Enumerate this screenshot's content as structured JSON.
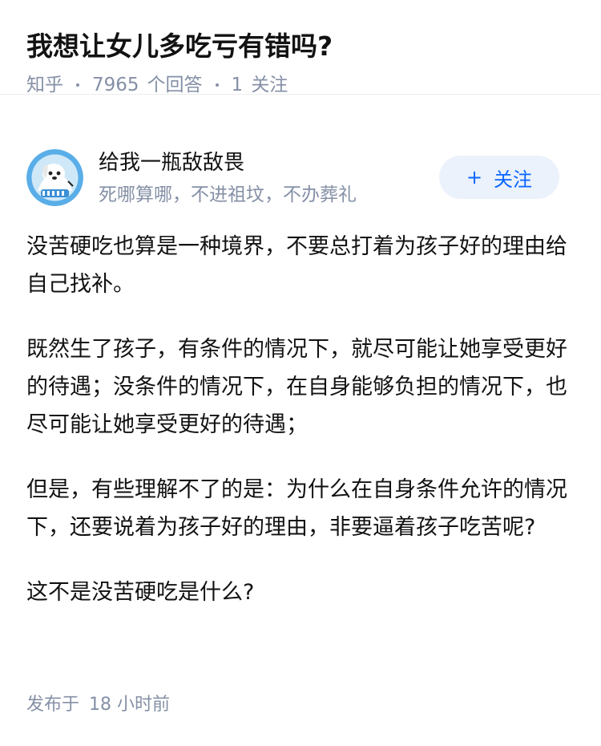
{
  "question": {
    "title": "我想让女儿多吃亏有错吗?",
    "source": "知乎",
    "answer_count": "7965",
    "answer_label": "个回答",
    "follow_count": "1",
    "follow_label": "关注"
  },
  "author": {
    "name": "给我一瓶敌敌畏",
    "bio": "死哪算哪，不进祖坟，不办葬礼",
    "avatar_icon": "dog-avatar-icon",
    "follow_button": {
      "icon": "plus-icon",
      "plus": "+",
      "label": "关注"
    }
  },
  "answer": {
    "paragraphs": [
      "没苦硬吃也算是一种境界，不要总打着为孩子好的理由给自己找补。",
      "既然生了孩子，有条件的情况下，就尽可能让她享受更好的待遇；没条件的情况下，在自身能够负担的情况下，也尽可能让她享受更好的待遇；",
      "但是，有些理解不了的是：为什么在自身条件允许的情况下，还要说着为孩子好的理由，非要逼着孩子吃苦呢?",
      "这不是没苦硬吃是什么?"
    ],
    "published_prefix": "发布于",
    "published_time": "18 小时前"
  },
  "colors": {
    "meta_gray": "#8590a6",
    "accent_blue": "#0a66ff",
    "follow_bg": "#ebf2fc",
    "avatar_blue": "#5aaee8"
  }
}
